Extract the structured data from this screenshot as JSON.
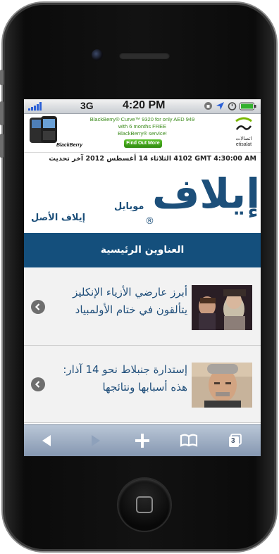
{
  "status_bar": {
    "carrier_network": "3G",
    "time": "4:20 PM"
  },
  "ad_banner": {
    "brand_left": "BlackBerry",
    "line1": "BlackBerry® Curve™ 9320 for only AED 949",
    "line2": "with 6 months FREE",
    "line3": "BlackBerry® service!",
    "button": "Find Out More",
    "brand_right": "etisalat",
    "brand_right_ar": "اتصالات"
  },
  "dateline": {
    "gmt_time": "GMT 4:30:00 AM",
    "text": "4102 الثلاثاء 14 أغسطس 2012 آخر تحديث"
  },
  "header": {
    "logo_text": "إيلاف",
    "logo_sub": "موبايل",
    "logo_reg": "®",
    "original_link": "إيلاف الأصل"
  },
  "section": {
    "title": "العناوين الرئيسية"
  },
  "articles": [
    {
      "title": "أبرز عارضي الأزياء الإنكليز يتألقون في ختام الأولمبياد"
    },
    {
      "title": "إستدارة جنبلاط نحو 14 آذار: هذه أسبابها ونتائجها"
    }
  ],
  "toolbar": {
    "tab_count": "3"
  },
  "colors": {
    "brand_blue": "#1c4f7a",
    "section_bar": "#144f7c",
    "link_blue": "#1f4e7a"
  }
}
